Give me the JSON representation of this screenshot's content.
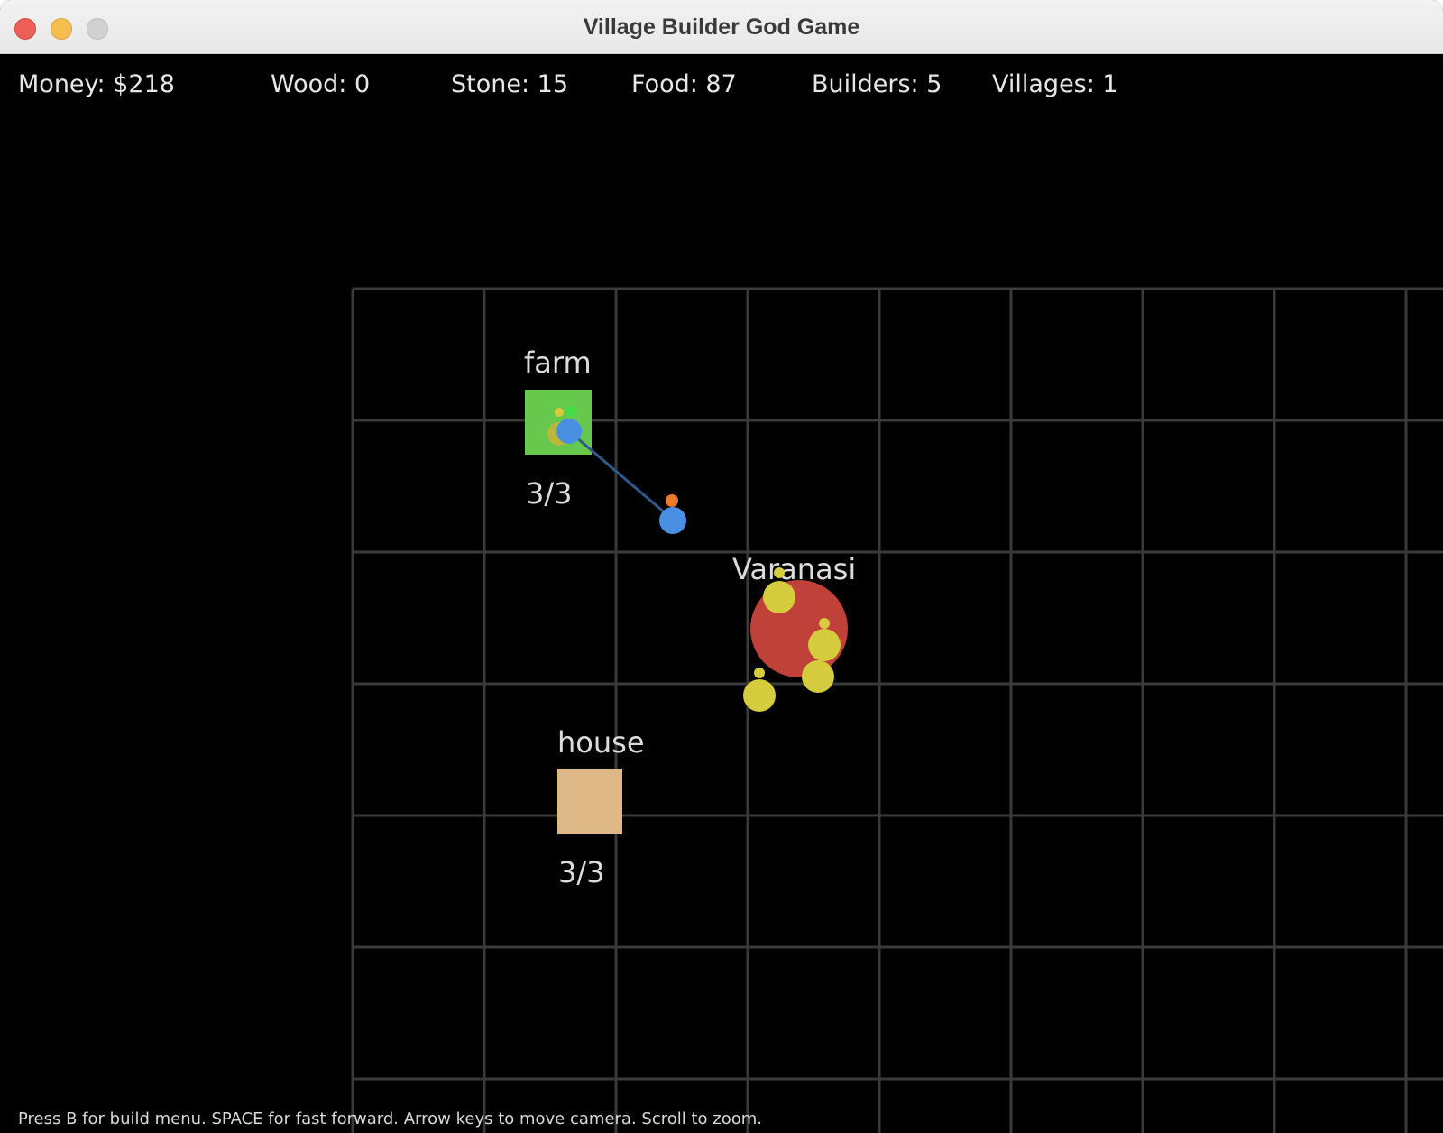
{
  "window": {
    "title": "Village Builder God Game"
  },
  "hud": {
    "money": "Money: $218",
    "wood": "Wood: 0",
    "stone": "Stone: 15",
    "food": "Food: 87",
    "builders": "Builders: 5",
    "villages": "Villages: 1"
  },
  "world": {
    "farm": {
      "label": "farm",
      "capacity": "3/3",
      "color": "#66c84c"
    },
    "house": {
      "label": "house",
      "capacity": "3/3",
      "color": "#deb887"
    },
    "village": {
      "name": "Varanasi",
      "color": "#c0403a"
    },
    "worker_color": "#4a90e2",
    "villager_color": "#d4cc3c",
    "carry_color_food": "#f07a2a",
    "grid_color": "#3a3a3a"
  },
  "help": "Press B for build menu. SPACE for fast forward. Arrow keys to move camera. Scroll to zoom."
}
